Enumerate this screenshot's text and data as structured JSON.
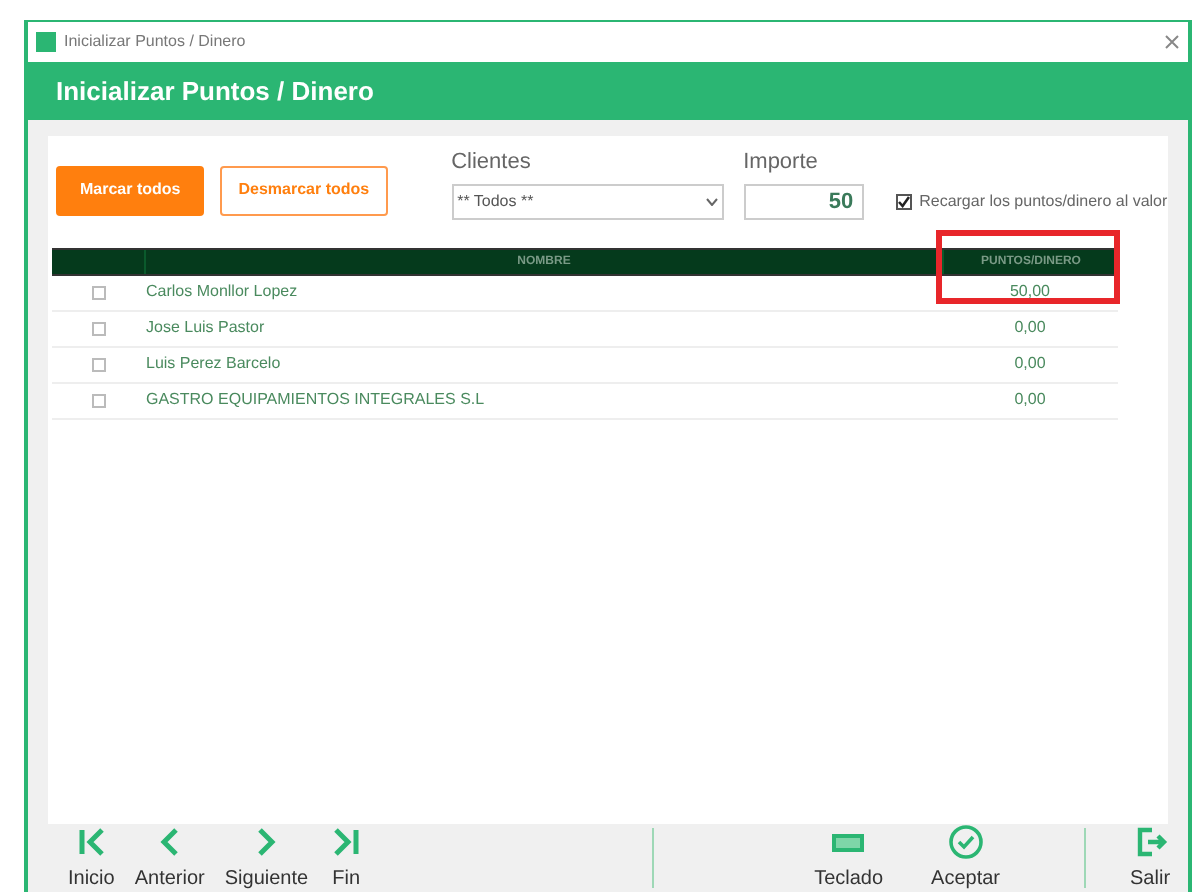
{
  "window": {
    "title": "Inicializar Puntos / Dinero"
  },
  "header": {
    "title": "Inicializar Puntos / Dinero"
  },
  "buttons": [
    {
      "label": "Marcar todos",
      "kind": "filled"
    },
    {
      "label": "Desmarcar todos",
      "kind": "outline"
    }
  ],
  "clientes": {
    "label": "Clientes",
    "value": "** Todos **"
  },
  "importe": {
    "label": "Importe",
    "value": "50"
  },
  "recargar": {
    "label": "Recargar los puntos/dinero al valor",
    "checked": true
  },
  "table": {
    "columns": [
      "NOMBRE",
      "PUNTOS/DINERO"
    ],
    "rows": [
      {
        "checked": false,
        "name": "Carlos Monllor Lopez",
        "value": "50,00",
        "highlighted": true
      },
      {
        "checked": false,
        "name": "Jose Luis Pastor",
        "value": "0,00",
        "highlighted": false
      },
      {
        "checked": false,
        "name": "Luis Perez Barcelo",
        "value": "0,00",
        "highlighted": false
      },
      {
        "checked": false,
        "name": "GASTRO EQUIPAMIENTOS INTEGRALES S.L",
        "value": "0,00",
        "highlighted": false
      }
    ]
  },
  "toolbar": [
    {
      "label": "Inicio",
      "kind": "first"
    },
    {
      "label": "Anterior",
      "kind": "prev"
    },
    {
      "label": "Siguiente",
      "kind": "next"
    },
    {
      "label": "Fin",
      "kind": "last"
    },
    {
      "label": "Teclado",
      "kind": "keyboard"
    },
    {
      "label": "Aceptar",
      "kind": "accept"
    },
    {
      "label": "Salir",
      "kind": "exit"
    }
  ]
}
